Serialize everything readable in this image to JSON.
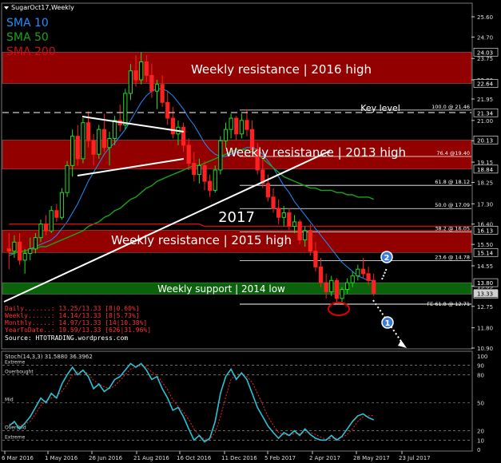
{
  "window": {
    "title": "SugarOct17,Weekly"
  },
  "legend": [
    {
      "label": "SMA 10",
      "color": "#1e90ff"
    },
    {
      "label": "SMA 50",
      "color": "#1aa31a"
    },
    {
      "label": "SMA 200",
      "color": "#d01010"
    }
  ],
  "zones": [
    {
      "label": "Weekly resistance | 2016 high",
      "from": 22.64,
      "to": 24.03,
      "color": "#a00000"
    },
    {
      "label": "Weekly resistance | 2013 high",
      "from": 18.84,
      "to": 20.13,
      "color": "#a00000"
    },
    {
      "label": "Weekly resistance | 2015 high",
      "from": 15.14,
      "to": 16.13,
      "color": "#a00000"
    },
    {
      "label": "Weekly support | 2014 low",
      "from": 13.29,
      "to": 13.8,
      "color": "#0b6b0b"
    }
  ],
  "fib_levels": [
    {
      "label": "100.0 @ 21.46",
      "value": 21.46
    },
    {
      "label": "76.4 @19.40",
      "value": 19.4
    },
    {
      "label": "61.8 @ 18.12",
      "value": 18.12
    },
    {
      "label": "50.0 @ 17.09",
      "value": 17.09
    },
    {
      "label": "38.2 @ 16.05",
      "value": 16.05
    },
    {
      "label": "23.6 @ 14.78",
      "value": 14.78
    },
    {
      "label": "FE 61.8 @ 12.71",
      "value": 12.71
    }
  ],
  "annotations": {
    "key_level": "Key level",
    "key_level_value": 21.34,
    "year": "2017",
    "marker_2": "2",
    "marker_1": "1"
  },
  "info_panel": [
    {
      "label": "Daily.......: 13.25/13.33 [8|0.60%]"
    },
    {
      "label": "Weekly......: 14.14/13.33 [8|5.73%]"
    },
    {
      "label": "Monthly.....: 14.97/13.33 [14|10.38%]"
    },
    {
      "label": "YearToDate..: 19.59/13.33 [626|31.96%]"
    }
  ],
  "source": "Source: HTOTRADING.wordpress.com",
  "price_axis": {
    "ticks": [
      "25.60",
      "24.70",
      "23.75",
      "22.80",
      "21.95",
      "21.00",
      "20.10",
      "19.15",
      "18.25",
      "17.30",
      "16.40",
      "15.50",
      "14.55",
      "13.65",
      "12.75",
      "11.80",
      "10.90"
    ],
    "tick_values": [
      25.6,
      24.7,
      23.75,
      22.8,
      21.95,
      21.0,
      20.1,
      19.15,
      18.25,
      17.3,
      16.4,
      15.5,
      14.55,
      13.65,
      12.75,
      11.8,
      10.9
    ],
    "highlighted": [
      {
        "label": "24.03",
        "value": 24.03
      },
      {
        "label": "22.64",
        "value": 22.64
      },
      {
        "label": "21.34",
        "value": 21.34
      },
      {
        "label": "20.13",
        "value": 20.13
      },
      {
        "label": "18.84",
        "value": 18.84
      },
      {
        "label": "16.13",
        "value": 16.13
      },
      {
        "label": "15.14",
        "value": 15.14
      },
      {
        "label": "13.80",
        "value": 13.8
      },
      {
        "label": "13.29",
        "value": 13.29
      }
    ],
    "last_price": {
      "label": "13.33",
      "value": 13.33
    }
  },
  "time_axis": [
    "6 Mar 2016",
    "1 May 2016",
    "26 Jun 2016",
    "21 Aug 2016",
    "16 Oct 2016",
    "11 Dec 2016",
    "5 Feb 2017",
    "2 Apr 2017",
    "28 May 2017",
    "23 Jul 2017"
  ],
  "oscillator": {
    "title": "Stoch(14,3,3) 31.5880 36.3962",
    "levels": [
      {
        "label": "Extreme",
        "value": 90
      },
      {
        "label": "Overbought",
        "value": 80
      },
      {
        "label": "Mid",
        "value": 50
      },
      {
        "label": "Oversold",
        "value": 20
      },
      {
        "label": "Extreme",
        "value": 10
      }
    ],
    "axis": [
      "100",
      "90",
      "80",
      "50",
      "20",
      "10",
      "0"
    ]
  },
  "chart_data": {
    "type": "candlestick",
    "title": "SugarOct17,Weekly",
    "ylim": [
      10.9,
      25.6
    ],
    "candles": [
      [
        15.3,
        16.0,
        14.4,
        15.2
      ],
      [
        15.2,
        15.9,
        14.9,
        15.6
      ],
      [
        15.6,
        16.0,
        14.6,
        14.8
      ],
      [
        14.8,
        15.3,
        14.2,
        15.1
      ],
      [
        15.1,
        15.8,
        14.8,
        15.3
      ],
      [
        15.3,
        16.0,
        15.1,
        15.8
      ],
      [
        15.8,
        16.6,
        15.6,
        16.4
      ],
      [
        16.4,
        16.8,
        15.9,
        16.1
      ],
      [
        16.1,
        17.2,
        16.0,
        17.0
      ],
      [
        17.0,
        17.3,
        16.5,
        16.7
      ],
      [
        16.7,
        18.0,
        16.6,
        17.8
      ],
      [
        17.8,
        19.2,
        17.6,
        19.0
      ],
      [
        19.0,
        20.6,
        18.5,
        20.3
      ],
      [
        20.3,
        20.8,
        19.0,
        19.3
      ],
      [
        19.3,
        21.1,
        19.1,
        20.9
      ],
      [
        20.9,
        21.4,
        19.8,
        20.1
      ],
      [
        20.1,
        20.4,
        19.0,
        19.5
      ],
      [
        19.5,
        20.8,
        19.3,
        20.6
      ],
      [
        20.6,
        21.3,
        19.6,
        19.8
      ],
      [
        19.8,
        20.5,
        19.0,
        20.2
      ],
      [
        20.2,
        21.2,
        19.9,
        21.0
      ],
      [
        21.0,
        21.7,
        20.5,
        20.8
      ],
      [
        20.8,
        22.4,
        20.6,
        22.2
      ],
      [
        22.2,
        23.5,
        21.9,
        23.2
      ],
      [
        23.2,
        23.9,
        22.5,
        22.8
      ],
      [
        22.8,
        24.03,
        22.6,
        23.6
      ],
      [
        23.6,
        23.9,
        22.7,
        23.0
      ],
      [
        23.0,
        23.5,
        22.0,
        22.3
      ],
      [
        22.3,
        22.8,
        21.5,
        22.6
      ],
      [
        22.6,
        23.0,
        21.6,
        21.8
      ],
      [
        21.8,
        22.3,
        20.8,
        21.1
      ],
      [
        21.1,
        21.6,
        20.2,
        20.4
      ],
      [
        20.4,
        21.0,
        19.9,
        20.7
      ],
      [
        20.7,
        20.9,
        19.6,
        19.9
      ],
      [
        19.9,
        20.2,
        18.8,
        19.1
      ],
      [
        19.1,
        19.6,
        18.3,
        18.6
      ],
      [
        18.6,
        19.3,
        18.2,
        19.0
      ],
      [
        19.0,
        19.2,
        17.9,
        18.3
      ],
      [
        18.3,
        18.6,
        17.6,
        17.9
      ],
      [
        17.9,
        19.0,
        17.8,
        18.8
      ],
      [
        18.8,
        20.3,
        18.6,
        20.1
      ],
      [
        20.1,
        20.9,
        19.8,
        20.6
      ],
      [
        20.6,
        21.3,
        20.2,
        21.1
      ],
      [
        21.1,
        21.2,
        20.1,
        20.4
      ],
      [
        20.4,
        21.3,
        20.2,
        21.0
      ],
      [
        21.0,
        21.5,
        20.3,
        20.6
      ],
      [
        20.6,
        21.0,
        19.5,
        19.7
      ],
      [
        19.7,
        20.0,
        18.6,
        18.8
      ],
      [
        18.8,
        19.3,
        18.0,
        18.2
      ],
      [
        18.2,
        18.6,
        17.4,
        17.6
      ],
      [
        17.6,
        18.0,
        16.9,
        17.1
      ],
      [
        17.1,
        17.5,
        16.4,
        16.7
      ],
      [
        16.7,
        17.2,
        16.3,
        16.9
      ],
      [
        16.9,
        17.1,
        16.1,
        16.3
      ],
      [
        16.3,
        16.8,
        16.0,
        16.5
      ],
      [
        16.5,
        16.6,
        15.5,
        15.7
      ],
      [
        15.7,
        16.3,
        15.4,
        16.1
      ],
      [
        16.1,
        16.4,
        15.0,
        15.2
      ],
      [
        15.2,
        15.6,
        14.3,
        14.5
      ],
      [
        14.5,
        14.9,
        13.6,
        13.8
      ],
      [
        13.8,
        14.2,
        13.1,
        13.4
      ],
      [
        13.4,
        14.1,
        13.2,
        13.9
      ],
      [
        13.9,
        14.0,
        12.9,
        13.1
      ],
      [
        13.1,
        13.6,
        12.95,
        13.5
      ],
      [
        13.5,
        14.0,
        13.3,
        13.8
      ],
      [
        13.8,
        14.3,
        13.6,
        14.1
      ],
      [
        14.1,
        14.6,
        13.9,
        14.4
      ],
      [
        14.4,
        14.9,
        14.0,
        14.2
      ],
      [
        14.2,
        14.5,
        13.7,
        13.9
      ],
      [
        13.9,
        14.2,
        13.2,
        13.33
      ]
    ],
    "series": [
      {
        "name": "SMA 10",
        "values": [
          15.0,
          15.1,
          15.2,
          15.2,
          15.3,
          15.4,
          15.5,
          15.6,
          15.7,
          15.9,
          16.2,
          16.5,
          16.9,
          17.3,
          17.8,
          18.3,
          18.7,
          19.1,
          19.5,
          19.8,
          20.0,
          20.3,
          20.6,
          21.0,
          21.4,
          21.8,
          22.1,
          22.3,
          22.4,
          22.4,
          22.3,
          22.1,
          21.8,
          21.5,
          21.1,
          20.8,
          20.4,
          20.0,
          19.7,
          19.5,
          19.4,
          19.4,
          19.5,
          19.6,
          19.7,
          19.8,
          19.8,
          19.7,
          19.5,
          19.2,
          18.9,
          18.5,
          18.1,
          17.8,
          17.4,
          17.1,
          16.8,
          16.5,
          16.2,
          15.9,
          15.6,
          15.3,
          15.0,
          14.7,
          14.5,
          14.3,
          14.1,
          14.0,
          13.9,
          13.9
        ]
      },
      {
        "name": "SMA 50",
        "values": [
          15.1,
          15.1,
          15.2,
          15.2,
          15.3,
          15.3,
          15.4,
          15.4,
          15.5,
          15.6,
          15.7,
          15.8,
          15.9,
          16.0,
          16.1,
          16.3,
          16.4,
          16.5,
          16.7,
          16.8,
          17.0,
          17.1,
          17.3,
          17.5,
          17.6,
          17.8,
          18.0,
          18.1,
          18.3,
          18.4,
          18.5,
          18.6,
          18.7,
          18.8,
          18.9,
          19.0,
          19.0,
          19.1,
          19.2,
          19.3,
          19.4,
          19.5,
          19.6,
          19.7,
          19.7,
          19.7,
          19.6,
          19.5,
          19.3,
          19.1,
          18.9,
          18.7,
          18.5,
          18.4,
          18.3,
          18.2,
          18.1,
          18.0,
          18.0,
          17.9,
          17.9,
          17.9,
          17.8,
          17.8,
          17.7,
          17.7,
          17.6,
          17.6,
          17.6,
          17.5
        ]
      },
      {
        "name": "SMA 200",
        "values": [
          16.4,
          16.4,
          16.4,
          16.4,
          16.4,
          16.4,
          16.4,
          16.4,
          16.4,
          16.4,
          16.4,
          16.4,
          16.4,
          16.4,
          16.4,
          16.4,
          16.4,
          16.4,
          16.4,
          16.4,
          16.4,
          16.4,
          16.4,
          16.4,
          16.4,
          16.4,
          16.4,
          16.4,
          16.4,
          16.4,
          16.4,
          16.4,
          16.4,
          16.4,
          16.4,
          16.4,
          16.4,
          16.3,
          16.3,
          16.3,
          16.3,
          16.3,
          16.3,
          16.3,
          16.3,
          16.3,
          16.3,
          16.3,
          16.3,
          16.3,
          16.3,
          16.3,
          16.3,
          16.3,
          16.3,
          16.3,
          16.3,
          16.3,
          16.3,
          16.3,
          16.3,
          16.3,
          16.3,
          16.3,
          16.3,
          16.3,
          16.3,
          16.3,
          16.3,
          16.3
        ]
      }
    ],
    "stoch_k": [
      25,
      30,
      22,
      28,
      35,
      45,
      55,
      50,
      60,
      55,
      70,
      80,
      88,
      80,
      85,
      78,
      65,
      70,
      62,
      66,
      75,
      78,
      85,
      92,
      88,
      92,
      85,
      75,
      78,
      65,
      55,
      42,
      45,
      35,
      22,
      10,
      15,
      8,
      12,
      30,
      60,
      78,
      86,
      75,
      82,
      75,
      60,
      45,
      35,
      25,
      18,
      12,
      18,
      15,
      20,
      15,
      22,
      16,
      12,
      10,
      10,
      15,
      10,
      14,
      22,
      30,
      36,
      38,
      34,
      31.6
    ],
    "stoch_d": [
      27,
      28,
      25,
      27,
      30,
      38,
      47,
      52,
      55,
      57,
      62,
      70,
      80,
      83,
      84,
      81,
      74,
      70,
      67,
      65,
      68,
      74,
      80,
      86,
      88,
      90,
      88,
      83,
      79,
      72,
      64,
      53,
      46,
      40,
      32,
      22,
      15,
      11,
      11,
      18,
      35,
      56,
      75,
      80,
      81,
      78,
      72,
      60,
      48,
      35,
      26,
      18,
      16,
      15,
      17,
      17,
      18,
      18,
      16,
      13,
      11,
      12,
      12,
      13,
      16,
      22,
      30,
      35,
      36,
      36.4
    ],
    "stoch_ylim": [
      0,
      100
    ]
  }
}
